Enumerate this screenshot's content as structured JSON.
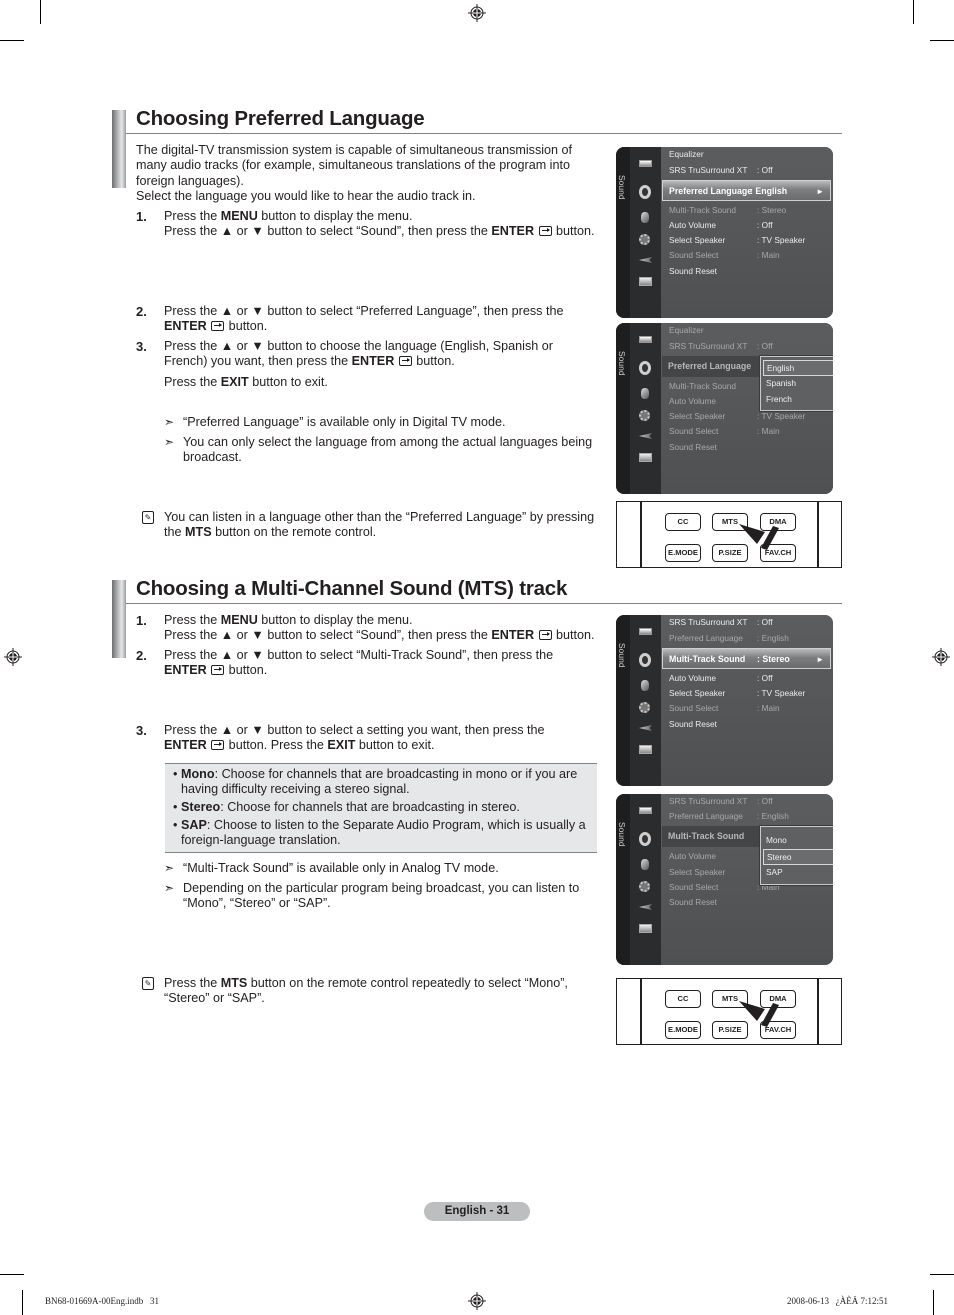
{
  "page": {
    "page_label": "English - 31",
    "footer_left": "BN68-01669A-00Eng.indb   31",
    "footer_right": "2008-06-13   ¿ÀÈÄ 7:12:51"
  },
  "section1": {
    "title": "Choosing Preferred Language",
    "intro": "The digital-TV transmission system is capable of simultaneous transmission of many audio tracks (for example, simultaneous translations of the program into foreign languages).",
    "intro2": "Select the language you would like to hear the audio track in.",
    "steps": [
      {
        "num": "1.",
        "l1_a": "Press the ",
        "l1_b": "MENU",
        "l1_c": " button to display the menu.",
        "l2_a": "Press the ▲ or ▼ button to select “Sound”, then press the ",
        "l2_b": "ENTER",
        "l2_c": " button."
      },
      {
        "num": "2.",
        "l1_a": "Press the ▲ or ▼ button to select “Preferred Language”, then press the",
        "l2_b": "ENTER",
        "l2_c": " button."
      },
      {
        "num": "3.",
        "l1_a": "Press the ▲ or ▼ button to choose the language (English, Spanish or",
        "l2_a": "French) you want, then press the ",
        "l2_b": "ENTER",
        "l2_c": " button.",
        "l3_a": "Press the ",
        "l3_b": "EXIT",
        "l3_c": " button to exit."
      }
    ],
    "notes": [
      "“Preferred Language” is available only in Digital TV mode.",
      "You can only select the language from among the actual languages being broadcast."
    ],
    "memo_a": "You can listen in a language other than the “Preferred Language” by pressing the ",
    "memo_b": "MTS",
    "memo_c": " button on the remote control."
  },
  "section2": {
    "title": "Choosing a Multi-Channel Sound (MTS) track",
    "steps": [
      {
        "num": "1.",
        "l1_a": "Press the ",
        "l1_b": "MENU",
        "l1_c": " button to display the menu.",
        "l2_a": "Press the ▲ or ▼ button to select “Sound”, then press the ",
        "l2_b": "ENTER",
        "l2_c": " button."
      },
      {
        "num": "2.",
        "l1_a": "Press the ▲ or ▼ button to select “Multi-Track Sound”, then press the",
        "l2_b": "ENTER",
        "l2_c": " button."
      },
      {
        "num": "3.",
        "l1_a": "Press the ▲ or ▼ button to select a setting you want, then press the",
        "l2_b": "ENTER",
        "l2_c": " button. Press the ",
        "l2_d": "EXIT",
        "l2_e": " button to exit."
      }
    ],
    "bullets": [
      {
        "term": "Mono",
        "desc": ": Choose for channels that are broadcasting in mono or if you are having difficulty receiving a stereo signal."
      },
      {
        "term": "Stereo",
        "desc": ": Choose for channels that are broadcasting in stereo."
      },
      {
        "term": "SAP",
        "desc": ": Choose to listen to the Separate Audio Program, which is usually a foreign-language translation."
      }
    ],
    "notes": [
      "“Multi-Track Sound” is available only in Analog TV mode.",
      "Depending on the particular program being broadcast, you can listen to “Mono”, “Stereo” or “SAP”."
    ],
    "memo_a": "Press the ",
    "memo_b": "MTS",
    "memo_c": " button on the remote control repeatedly to select “Mono”, “Stereo” or “SAP”."
  },
  "osd": {
    "side_label": "Sound",
    "menu1": [
      {
        "label": "Equalizer",
        "value": ""
      },
      {
        "label": "SRS TruSurround XT",
        "value": ": Off"
      },
      {
        "label": "Preferred Language",
        "value": ": English"
      },
      {
        "label": "Multi-Track Sound",
        "value": ": Stereo"
      },
      {
        "label": "Auto Volume",
        "value": ": Off"
      },
      {
        "label": "Select Speaker",
        "value": ": TV Speaker"
      },
      {
        "label": "Sound Select",
        "value": ": Main"
      },
      {
        "label": "Sound Reset",
        "value": ""
      }
    ],
    "menu2": [
      {
        "label": "SRS TruSurround XT",
        "value": ": Off"
      },
      {
        "label": "Preferred Language",
        "value": ": English"
      },
      {
        "label": "Multi-Track Sound",
        "value": ": Stereo"
      },
      {
        "label": "Auto Volume",
        "value": ": Off"
      },
      {
        "label": "Select Speaker",
        "value": ": TV Speaker"
      },
      {
        "label": "Sound Select",
        "value": ": Main"
      },
      {
        "label": "Sound Reset",
        "value": ""
      }
    ],
    "lang_options": [
      "English",
      "Spanish",
      "French"
    ],
    "lang_selected": "English",
    "mts_options": [
      "Mono",
      "Stereo",
      "SAP"
    ],
    "mts_selected": "Stereo",
    "arrow": "►",
    "icons": [
      "picture-icon",
      "sound-icon",
      "channel-icon",
      "setup-icon",
      "input-icon",
      "application-icon"
    ]
  },
  "remote": {
    "row1": [
      "CC",
      "MTS",
      "DMA"
    ],
    "row2": [
      "E.MODE",
      "P.SIZE",
      "FAV.CH"
    ]
  },
  "glyphs": {
    "arrow_note": "➣",
    "bullet": "•",
    "memo": "✎"
  }
}
